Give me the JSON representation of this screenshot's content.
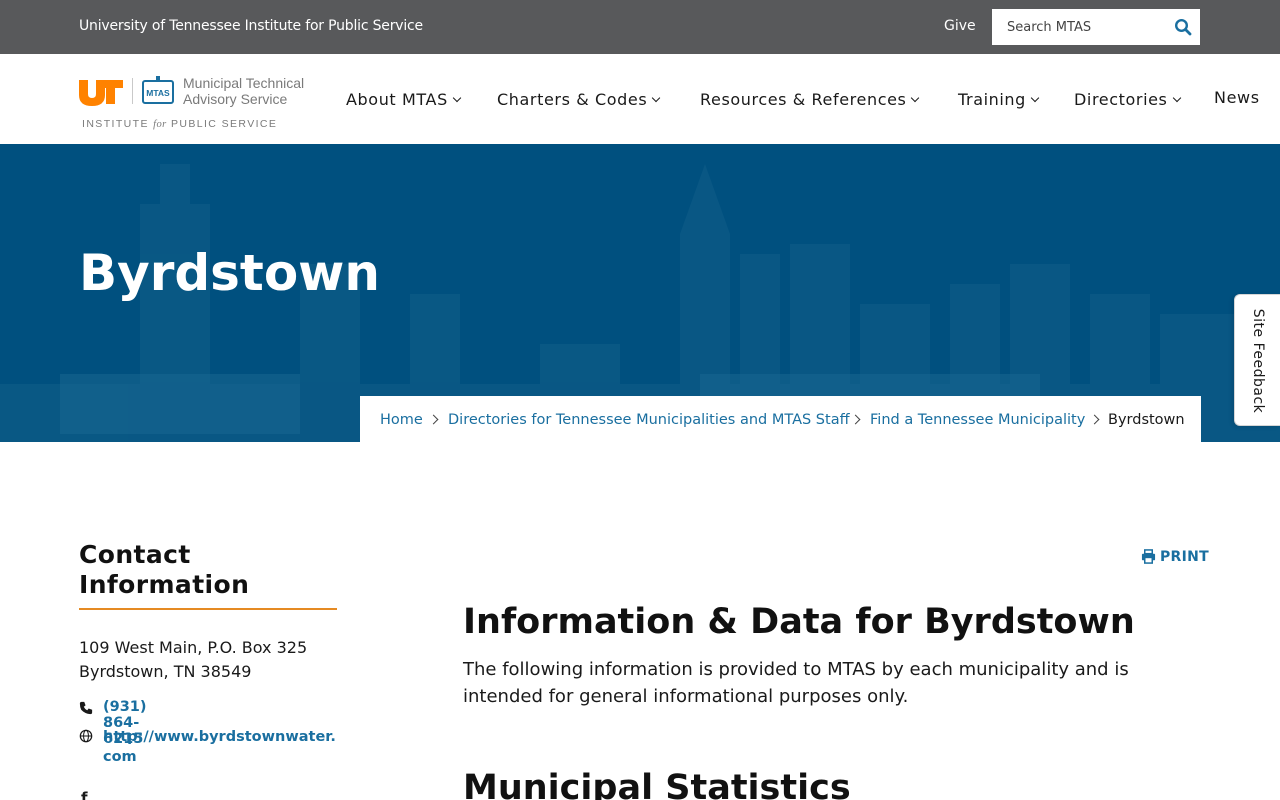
{
  "utility_bar": {
    "org_name": "University of Tennessee Institute for Public Service",
    "give_label": "Give",
    "search_placeholder": "Search MTAS"
  },
  "logo": {
    "badge_text": "MTAS",
    "name_line1": "Municipal Technical",
    "name_line2": "Advisory Service",
    "institute_prefix": "INSTITUTE ",
    "institute_for": "for",
    "institute_suffix": " PUBLIC SERVICE"
  },
  "nav": {
    "items": [
      {
        "label": "About MTAS",
        "has_dropdown": true
      },
      {
        "label": "Charters & Codes",
        "has_dropdown": true
      },
      {
        "label": "Resources & References",
        "has_dropdown": true
      },
      {
        "label": "Training",
        "has_dropdown": true
      },
      {
        "label": "Directories",
        "has_dropdown": true
      },
      {
        "label": "News",
        "has_dropdown": false
      }
    ]
  },
  "hero": {
    "title": "Byrdstown"
  },
  "breadcrumb": {
    "items": [
      {
        "label": "Home"
      },
      {
        "label": "Directories for Tennessee Municipalities and MTAS Staff"
      },
      {
        "label": "Find a Tennessee Municipality"
      }
    ],
    "current": "Byrdstown"
  },
  "feedback_tab": {
    "label": "Site Feedback"
  },
  "sidebar": {
    "heading_line1": "Contact",
    "heading_line2": "Information",
    "address_line1": "109 West Main, P.O. Box 325",
    "address_line2": "Byrdstown, TN 38549",
    "phone": "(931) 864-6215",
    "website": "http://www.byrdstownwater.com",
    "facebook_glyph": "f"
  },
  "main": {
    "print_label": "PRINT",
    "heading": "Information & Data for Byrdstown",
    "intro": "The following information is provided to MTAS by each municipality and is intended for general informational purposes only.",
    "stats_heading": "Municipal Statistics"
  },
  "colors": {
    "utility_bar": "#58595b",
    "hero_blue": "#00507f",
    "link_blue": "#1a6fa0",
    "accent_orange": "#e58a23",
    "ut_orange": "#ff8200"
  },
  "icons": {
    "search": "search-icon",
    "phone": "phone-icon",
    "globe": "globe-icon",
    "facebook": "facebook-icon",
    "print": "print-icon",
    "chevron": "chevron-down-icon"
  }
}
